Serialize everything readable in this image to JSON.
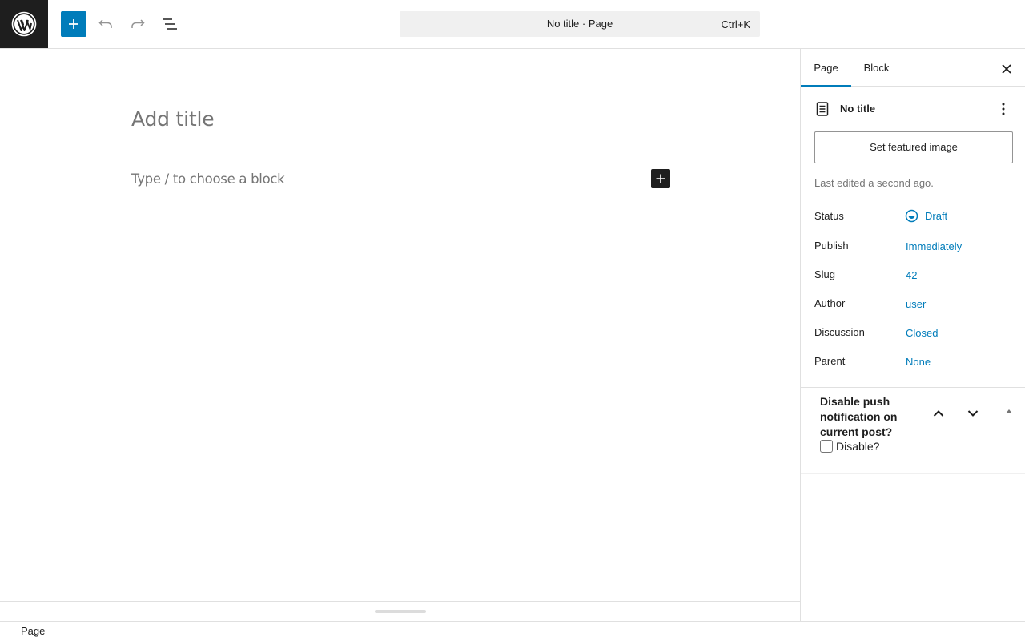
{
  "topbar": {
    "logo_icon": "wordpress-logo-icon",
    "add_icon": "plus-icon",
    "undo_icon": "undo-icon",
    "redo_icon": "redo-icon",
    "list_view_icon": "list-view-icon",
    "command_title": "No title · Page",
    "command_shortcut": "Ctrl+K",
    "accent_color": "#007cba"
  },
  "editor": {
    "title_placeholder": "Add title",
    "block_placeholder": "Type / to choose a block",
    "inline_add_icon": "plus-icon"
  },
  "sidebar": {
    "tabs": [
      {
        "label": "Page",
        "active": true
      },
      {
        "label": "Block",
        "active": false
      }
    ],
    "close_icon": "close-icon",
    "post_title": "No title",
    "featured_image_label": "Set featured image",
    "last_edited": "Last edited a second ago.",
    "rows": [
      {
        "label": "Status",
        "value": "Draft"
      },
      {
        "label": "Publish",
        "value": "Immediately"
      },
      {
        "label": "Slug",
        "value": "42"
      },
      {
        "label": "Author",
        "value": "user"
      },
      {
        "label": "Discussion",
        "value": "Closed"
      },
      {
        "label": "Parent",
        "value": "None"
      }
    ],
    "panel": {
      "title": "Disable push notification on current post?",
      "checkbox_label": "Disable?",
      "checked": false
    }
  },
  "footer": {
    "breadcrumb": "Page"
  }
}
